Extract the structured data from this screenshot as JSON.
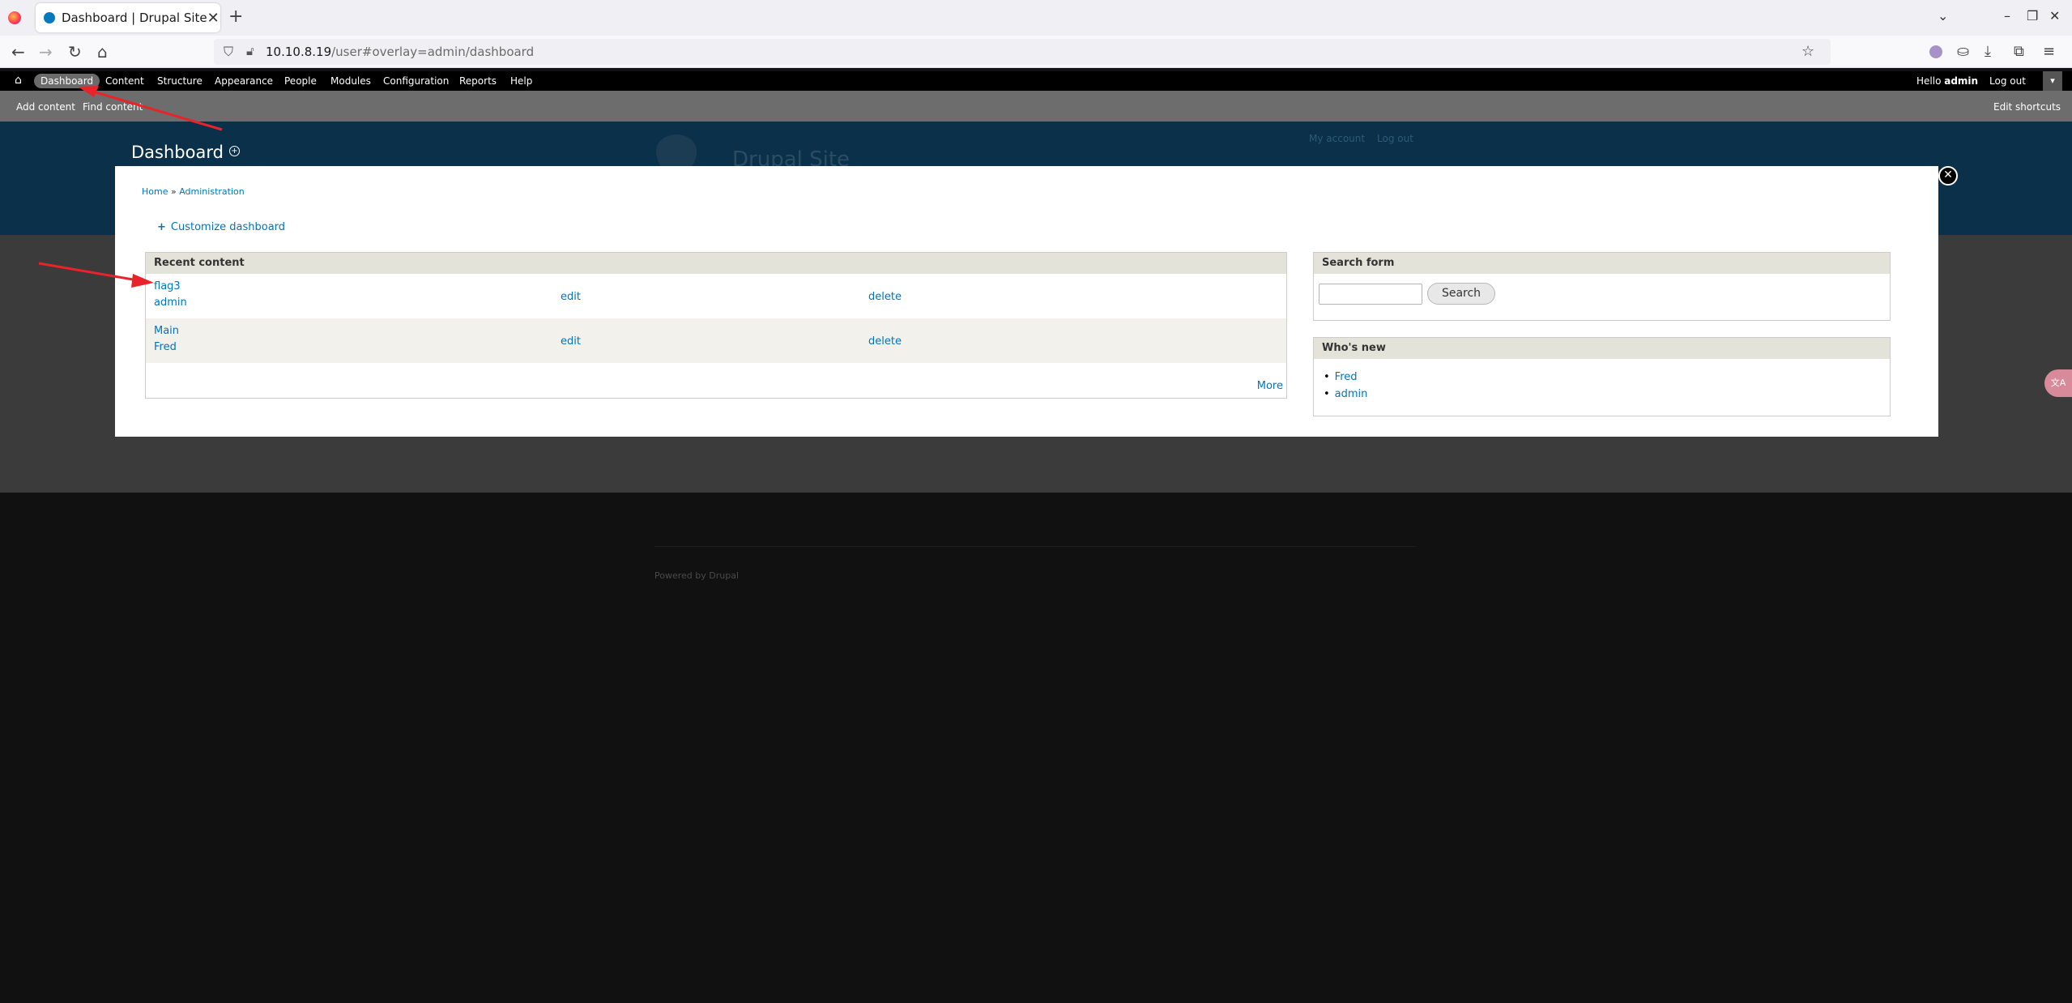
{
  "browser": {
    "tab_title": "Dashboard | Drupal Site",
    "tab_close": "✕",
    "new_tab": "+",
    "url_host": "10.10.8.19",
    "url_path": "/user#overlay=admin/dashboard"
  },
  "toolbar": {
    "menu": [
      "Dashboard",
      "Content",
      "Structure",
      "Appearance",
      "People",
      "Modules",
      "Configuration",
      "Reports",
      "Help"
    ],
    "hello_prefix": "Hello ",
    "username": "admin",
    "logout": "Log out"
  },
  "shortcuts": {
    "add_content": "Add content",
    "find_content": "Find content",
    "edit_shortcuts": "Edit shortcuts"
  },
  "site": {
    "page_title": "Dashboard",
    "site_name": "Drupal Site",
    "my_account": "My account",
    "logout": "Log out",
    "powered_by": "Powered by Drupal"
  },
  "overlay": {
    "breadcrumb": [
      "Home",
      "Administration"
    ],
    "breadcrumb_sep": " » ",
    "customize": "Customize dashboard",
    "recent_content": {
      "title": "Recent content",
      "rows": [
        {
          "title": "flag3",
          "author": "admin",
          "edit": "edit",
          "delete": "delete"
        },
        {
          "title": "Main",
          "author": "Fred",
          "edit": "edit",
          "delete": "delete"
        }
      ],
      "more": "More"
    },
    "search_form": {
      "title": "Search form",
      "button": "Search",
      "value": ""
    },
    "whos_new": {
      "title": "Who's new",
      "users": [
        "Fred",
        "admin"
      ]
    }
  },
  "colors": {
    "toolbar": "#000000",
    "shortcut_bar": "#6d6d6d",
    "site_header": "#0b3049",
    "link": "#0074bd",
    "annotation": "#e8232a"
  }
}
